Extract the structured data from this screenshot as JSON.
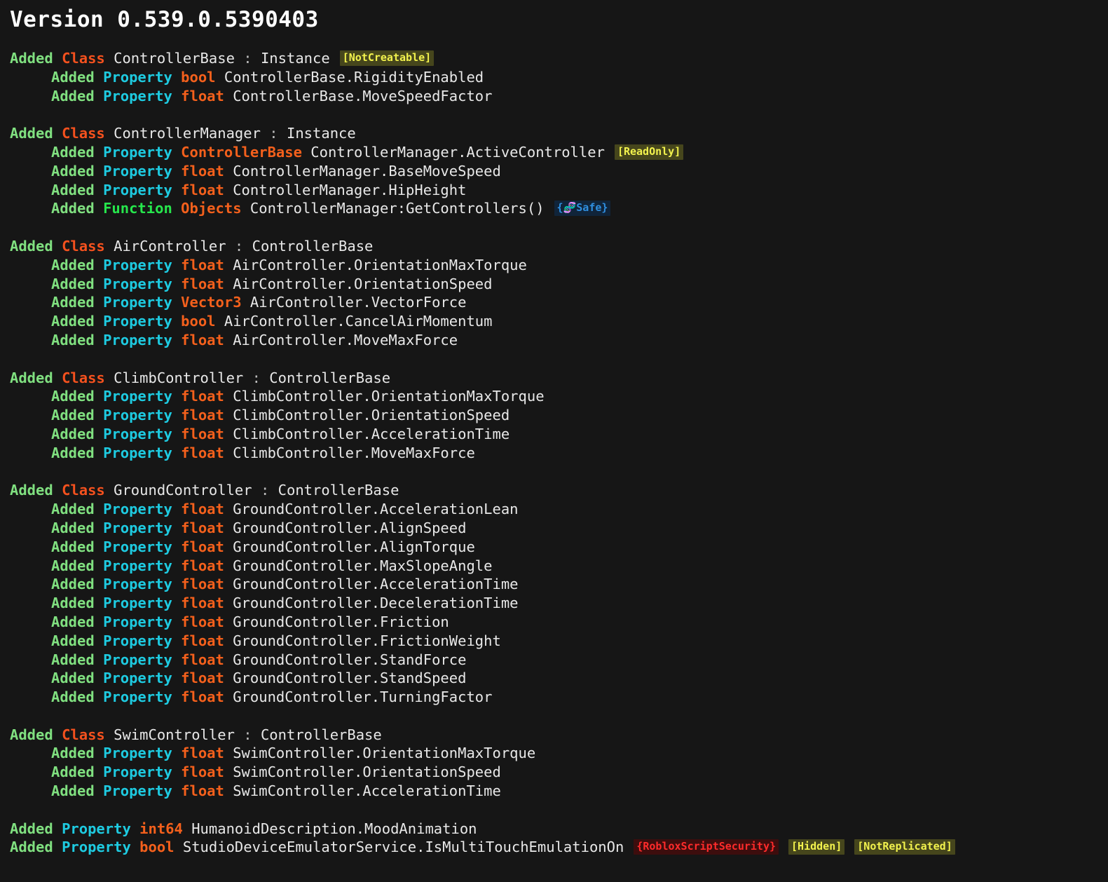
{
  "header": {
    "title": "Version 0.539.0.5390403"
  },
  "labels": {
    "added": "Added",
    "class": "Class",
    "property": "Property",
    "function": "Function",
    "colon": " : "
  },
  "tags": {
    "not_creatable": "[NotCreatable]",
    "read_only": "[ReadOnly]",
    "safe": "Safe",
    "safe_open": "{",
    "safe_close": "}",
    "safe_icon": "🧬",
    "roblox_script_security": "{RobloxScriptSecurity}",
    "hidden": "[Hidden]",
    "not_replicated": "[NotReplicated]"
  },
  "colors": {
    "background": "#161616",
    "added": "#80e080",
    "class_keyword": "#f4511e",
    "property_keyword": "#1ecbe1",
    "function_keyword": "#26e64c",
    "type": "#f4601c",
    "identifier": "#e8e8e8",
    "tag_yellow_text": "#f2f24d",
    "tag_yellow_bg": "#46461c",
    "tag_red_text": "#ff2b2b",
    "tag_red_bg": "#3d0d0d",
    "tag_blue_text": "#2f8fe0",
    "tag_blue_bg": "#10243a"
  },
  "groups": [
    {
      "class_name": "ControllerBase",
      "base": "Instance",
      "class_tag": "not_creatable",
      "members": [
        {
          "kind": "Property",
          "type": "bool",
          "name": "ControllerBase.RigidityEnabled"
        },
        {
          "kind": "Property",
          "type": "float",
          "name": "ControllerBase.MoveSpeedFactor"
        }
      ]
    },
    {
      "class_name": "ControllerManager",
      "base": "Instance",
      "class_tag": null,
      "members": [
        {
          "kind": "Property",
          "type": "ControllerBase",
          "name": "ControllerManager.ActiveController",
          "tag": "read_only"
        },
        {
          "kind": "Property",
          "type": "float",
          "name": "ControllerManager.BaseMoveSpeed"
        },
        {
          "kind": "Property",
          "type": "float",
          "name": "ControllerManager.HipHeight"
        },
        {
          "kind": "Function",
          "type": "Objects",
          "name": "ControllerManager:GetControllers()",
          "tag": "safe"
        }
      ]
    },
    {
      "class_name": "AirController",
      "base": "ControllerBase",
      "class_tag": null,
      "members": [
        {
          "kind": "Property",
          "type": "float",
          "name": "AirController.OrientationMaxTorque"
        },
        {
          "kind": "Property",
          "type": "float",
          "name": "AirController.OrientationSpeed"
        },
        {
          "kind": "Property",
          "type": "Vector3",
          "name": "AirController.VectorForce"
        },
        {
          "kind": "Property",
          "type": "bool",
          "name": "AirController.CancelAirMomentum"
        },
        {
          "kind": "Property",
          "type": "float",
          "name": "AirController.MoveMaxForce"
        }
      ]
    },
    {
      "class_name": "ClimbController",
      "base": "ControllerBase",
      "class_tag": null,
      "members": [
        {
          "kind": "Property",
          "type": "float",
          "name": "ClimbController.OrientationMaxTorque"
        },
        {
          "kind": "Property",
          "type": "float",
          "name": "ClimbController.OrientationSpeed"
        },
        {
          "kind": "Property",
          "type": "float",
          "name": "ClimbController.AccelerationTime"
        },
        {
          "kind": "Property",
          "type": "float",
          "name": "ClimbController.MoveMaxForce"
        }
      ]
    },
    {
      "class_name": "GroundController",
      "base": "ControllerBase",
      "class_tag": null,
      "members": [
        {
          "kind": "Property",
          "type": "float",
          "name": "GroundController.AccelerationLean"
        },
        {
          "kind": "Property",
          "type": "float",
          "name": "GroundController.AlignSpeed"
        },
        {
          "kind": "Property",
          "type": "float",
          "name": "GroundController.AlignTorque"
        },
        {
          "kind": "Property",
          "type": "float",
          "name": "GroundController.MaxSlopeAngle"
        },
        {
          "kind": "Property",
          "type": "float",
          "name": "GroundController.AccelerationTime"
        },
        {
          "kind": "Property",
          "type": "float",
          "name": "GroundController.DecelerationTime"
        },
        {
          "kind": "Property",
          "type": "float",
          "name": "GroundController.Friction"
        },
        {
          "kind": "Property",
          "type": "float",
          "name": "GroundController.FrictionWeight"
        },
        {
          "kind": "Property",
          "type": "float",
          "name": "GroundController.StandForce"
        },
        {
          "kind": "Property",
          "type": "float",
          "name": "GroundController.StandSpeed"
        },
        {
          "kind": "Property",
          "type": "float",
          "name": "GroundController.TurningFactor"
        }
      ]
    },
    {
      "class_name": "SwimController",
      "base": "ControllerBase",
      "class_tag": null,
      "members": [
        {
          "kind": "Property",
          "type": "float",
          "name": "SwimController.OrientationMaxTorque"
        },
        {
          "kind": "Property",
          "type": "float",
          "name": "SwimController.OrientationSpeed"
        },
        {
          "kind": "Property",
          "type": "float",
          "name": "SwimController.AccelerationTime"
        }
      ]
    }
  ],
  "standalone": [
    {
      "kind": "Property",
      "type": "int64",
      "name": "HumanoidDescription.MoodAnimation",
      "tags": []
    },
    {
      "kind": "Property",
      "type": "bool",
      "name": "StudioDeviceEmulatorService.IsMultiTouchEmulationOn",
      "tags": [
        "roblox_script_security",
        "hidden",
        "not_replicated"
      ]
    }
  ]
}
